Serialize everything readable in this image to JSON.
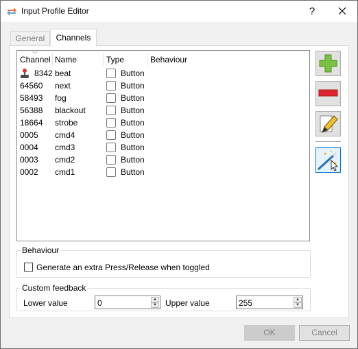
{
  "window": {
    "title": "Input Profile Editor",
    "help_label": "?"
  },
  "tabs": [
    {
      "label": "General",
      "selected": false
    },
    {
      "label": "Channels",
      "selected": true
    }
  ],
  "table": {
    "columns": [
      "Channel",
      "Name",
      "Type",
      "Behaviour"
    ],
    "rows": [
      {
        "channel": "8342",
        "name": "beat",
        "type": "Button",
        "icon": "joystick-icon"
      },
      {
        "channel": "64560",
        "name": "next",
        "type": "Button"
      },
      {
        "channel": "58493",
        "name": "fog",
        "type": "Button"
      },
      {
        "channel": "56388",
        "name": "blackout",
        "type": "Button"
      },
      {
        "channel": "18664",
        "name": "strobe",
        "type": "Button"
      },
      {
        "channel": "0005",
        "name": "cmd4",
        "type": "Button"
      },
      {
        "channel": "0004",
        "name": "cmd3",
        "type": "Button"
      },
      {
        "channel": "0003",
        "name": "cmd2",
        "type": "Button"
      },
      {
        "channel": "0002",
        "name": "cmd1",
        "type": "Button"
      }
    ]
  },
  "side_buttons": [
    {
      "name": "add-channel-button",
      "icon": "plus-icon"
    },
    {
      "name": "remove-channel-button",
      "icon": "minus-icon"
    },
    {
      "name": "edit-channel-button",
      "icon": "pencil-icon"
    },
    {
      "name": "wizard-button",
      "icon": "magic-wand-icon"
    }
  ],
  "behaviour": {
    "title": "Behaviour",
    "extra_press_label": "Generate an extra Press/Release when toggled",
    "extra_press_checked": false
  },
  "feedback": {
    "title": "Custom feedback",
    "lower_label": "Lower value",
    "lower_value": "0",
    "upper_label": "Upper value",
    "upper_value": "255"
  },
  "buttons": {
    "ok": "OK",
    "cancel": "Cancel"
  },
  "colors": {
    "plus": "#7ac142",
    "minus": "#e0262b",
    "focus": "#0078d7"
  }
}
